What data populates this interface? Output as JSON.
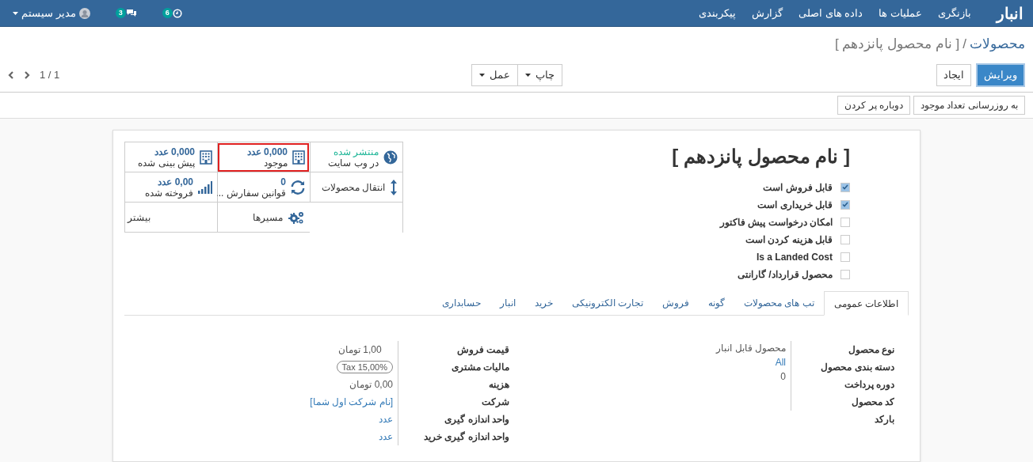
{
  "topbar": {
    "brand": "انبار",
    "menu": [
      "بازنگری",
      "عملیات ها",
      "داده های اصلی",
      "گزارش",
      "پیکربندی"
    ],
    "activity_count": "6",
    "message_count": "3",
    "user": "مدیر سیستم"
  },
  "breadcrumb": {
    "parent": "محصولات",
    "separator": "/",
    "current": "[ نام محصول پانزدهم ]"
  },
  "buttons": [
    {
      "label": "ویرایش",
      "kind": "primary"
    },
    {
      "label": "ایجاد",
      "kind": "default"
    }
  ],
  "dropdowns": [
    "چاپ",
    "عمل"
  ],
  "pager": "1 / 1",
  "header_buttons": [
    "به روزرسانی تعداد موجود",
    "دوباره پر کردن"
  ],
  "smart_buttons": [
    {
      "kind": "website",
      "value": "منتشر شده",
      "label": "در وب سایت",
      "highlighted": false
    },
    {
      "kind": "stock",
      "value": "0,000 عدد",
      "label": "موجود",
      "highlighted": true
    },
    {
      "kind": "stock",
      "value": "0,000 عدد",
      "label": "پیش بینی شده",
      "highlighted": false
    },
    {
      "kind": "moves",
      "label": "انتقال محصولات",
      "highlighted": false
    },
    {
      "kind": "rules",
      "value": "0",
      "label": "قوانین سفارش ...",
      "highlighted": false
    },
    {
      "kind": "sales",
      "value": "0,00 عدد",
      "label": "فروخته شده",
      "highlighted": false
    },
    {
      "kind": "routes",
      "label": "مسیرها",
      "highlighted": false
    },
    {
      "kind": "more",
      "label": "بیشتر",
      "highlighted": false
    }
  ],
  "title": "[ نام محصول پانزدهم ]",
  "checkboxes": [
    {
      "label": "قابل فروش است",
      "checked": true
    },
    {
      "label": "قابل خریداری است",
      "checked": true
    },
    {
      "label": "امکان درخواست پیش فاکتور",
      "checked": false
    },
    {
      "label": "قابل هزینه کردن است",
      "checked": false
    },
    {
      "label": "Is a Landed Cost",
      "checked": false
    },
    {
      "label": "محصول قرارداد/ گارانتی",
      "checked": false
    }
  ],
  "tabs": [
    {
      "label": "اطلاعات عمومی",
      "selected": true
    },
    {
      "label": "تب های محصولات",
      "selected": false
    },
    {
      "label": "گونه",
      "selected": false
    },
    {
      "label": "فروش",
      "selected": false
    },
    {
      "label": "تجارت الکترونیکی",
      "selected": false
    },
    {
      "label": "خرید",
      "selected": false
    },
    {
      "label": "انبار",
      "selected": false
    },
    {
      "label": "حسابداری",
      "selected": false
    }
  ],
  "field_groups": [
    [
      {
        "label": "نوع محصول",
        "value": "محصول قابل انبار",
        "kind": "text"
      },
      {
        "label": "دسته بندی محصول",
        "value": "All",
        "kind": "link"
      },
      {
        "label": "دوره پرداخت",
        "value": "0",
        "kind": "text"
      },
      {
        "label": "کد محصول",
        "kind": "empty"
      },
      {
        "label": "بارکد",
        "kind": "empty"
      }
    ],
    [
      {
        "label": "قیمت فروش",
        "value": "1,00 تومان",
        "kind": "amount"
      },
      {
        "label": "مالیات مشتری",
        "value": "Tax 15,00%",
        "kind": "tag"
      },
      {
        "label": "هزینه",
        "value": "0,00 تومان",
        "kind": "text"
      },
      {
        "label": "شرکت",
        "value": "[نام شرکت اول شما]",
        "kind": "link"
      },
      {
        "label": "واحد اندازه گیری",
        "value": "عدد",
        "kind": "link"
      },
      {
        "label": "واحد اندازه گیری خرید",
        "value": "عدد",
        "kind": "link"
      }
    ]
  ]
}
